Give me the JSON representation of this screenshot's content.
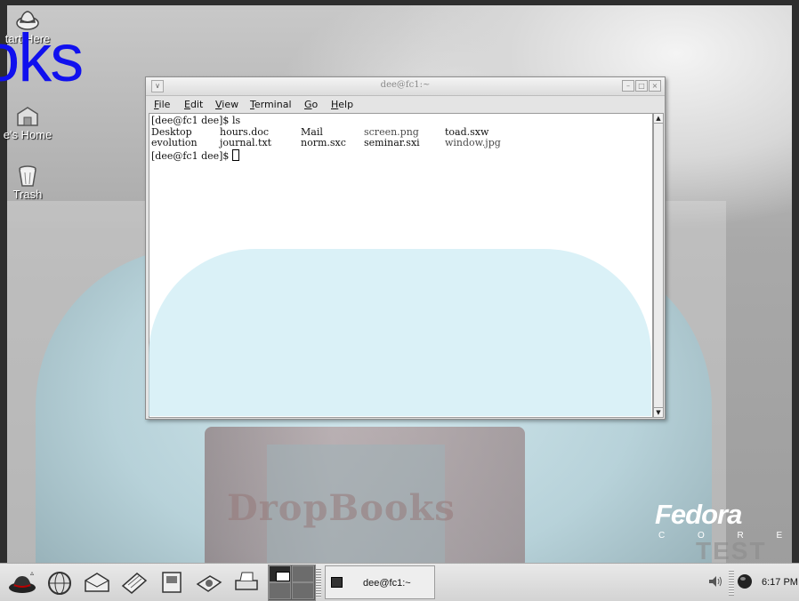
{
  "desktop": {
    "icons": [
      {
        "label": "tart Here",
        "icon": "start-here-icon"
      },
      {
        "label": "e's Home",
        "icon": "home-folder-icon"
      },
      {
        "label": "Trash",
        "icon": "trash-icon"
      }
    ],
    "overlay_text": "oks",
    "wallpaper_text": "DropBooks",
    "brand": "Fedora",
    "brand_sub": "C O R E",
    "brand_stamp": "TEST"
  },
  "window": {
    "title": "dee@fc1:~",
    "controls": [
      "minimize",
      "maximize",
      "close"
    ],
    "menu": [
      {
        "label": "File",
        "accel": "F"
      },
      {
        "label": "Edit",
        "accel": "E"
      },
      {
        "label": "View",
        "accel": "V"
      },
      {
        "label": "Terminal",
        "accel": "T"
      },
      {
        "label": "Go",
        "accel": "G"
      },
      {
        "label": "Help",
        "accel": "H"
      }
    ],
    "terminal": {
      "prompt": "[dee@fc1 dee]$",
      "command": "ls",
      "listing_rows": [
        [
          "Desktop",
          "hours.doc",
          "Mail",
          "screen.png",
          "toad.sxw"
        ],
        [
          "evolution",
          "journal.txt",
          "norm.sxc",
          "seminar.sxi",
          "window.jpg"
        ]
      ]
    }
  },
  "panel": {
    "launchers": [
      "redhat-menu-icon",
      "web-browser-icon",
      "email-icon",
      "writer-icon",
      "impress-icon",
      "calc-icon",
      "print-manager-icon"
    ],
    "workspaces": 4,
    "active_workspace": 1,
    "task": {
      "label": "dee@fc1:~",
      "icon": "terminal-icon"
    },
    "volume_icon": "volume-icon",
    "status_icon": "network-status-icon",
    "clock": "6:17 PM"
  }
}
